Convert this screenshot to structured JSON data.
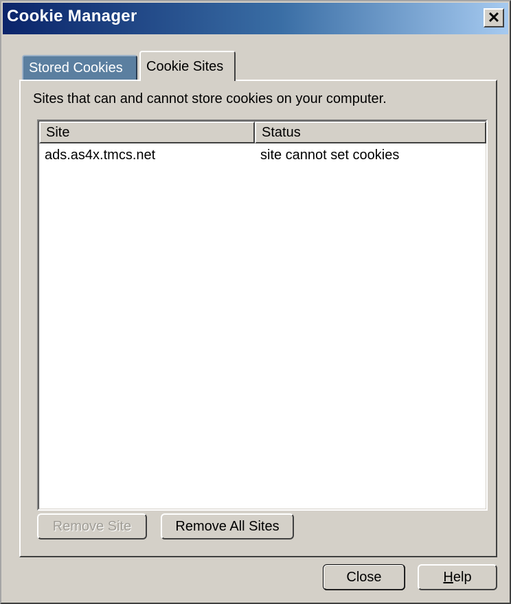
{
  "window": {
    "title": "Cookie Manager",
    "close_glyph": "✕"
  },
  "tabs": [
    {
      "label": "Stored Cookies",
      "active": false
    },
    {
      "label": "Cookie Sites",
      "active": true
    }
  ],
  "panel": {
    "description": "Sites that can and cannot store cookies on your computer.",
    "columns": [
      "Site",
      "Status"
    ],
    "rows": [
      {
        "site": "ads.as4x.tmcs.net",
        "status": "site cannot set cookies"
      }
    ]
  },
  "buttons": {
    "remove_site": "Remove Site",
    "remove_all_sites": "Remove All Sites",
    "close": "Close",
    "help_mnemonic": "H",
    "help_rest": "elp"
  },
  "colors": {
    "dialog_background": "#d4d0c8",
    "titlebar_start": "#0a246a",
    "titlebar_end": "#a6caf0",
    "inactive_tab": "#5b7fa0"
  }
}
